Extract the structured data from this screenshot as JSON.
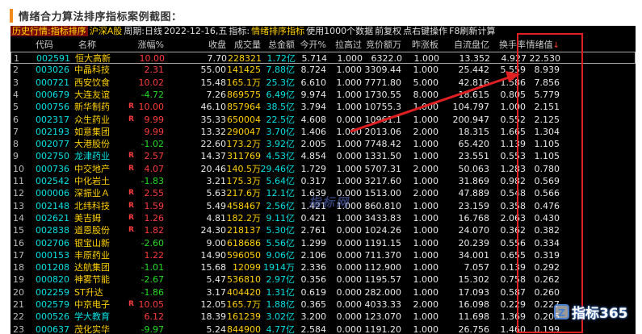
{
  "article": {
    "heading": "情绪合力算法排序指标案例截图："
  },
  "infobar": {
    "mode": "历史行情:指标排序",
    "sector": "沪深A股",
    "period": "周期:日线",
    "date": "2022-12-16,五",
    "indicator_label": "指标:",
    "indicator": "情绪排序指标",
    "data_note": "使用1000个数据",
    "adjust": "前复权",
    "hint": "点右键操作",
    "refresh": "F8刷新计算"
  },
  "columns": {
    "code": "代码",
    "name": "名称",
    "change": "涨幅%",
    "close": "收盘",
    "volume": "成交量",
    "amount": "总金额",
    "ratio": "今开%",
    "liangbi": "拉高过",
    "jingjia": "竞价额万",
    "zuozhang": "昨涨板",
    "liutong": "自流盘亿",
    "turnover": "换手率",
    "emotion": "情绪值",
    "sort_mark": "↓"
  },
  "rows": [
    {
      "idx": "1",
      "code": "002591",
      "name": "恒大高新",
      "r": "",
      "change": "10.00",
      "close": "7.70",
      "volume": "228321",
      "amount": "1.72亿",
      "ratio": "5.714",
      "liangbi": "1.000",
      "jingjia": "6322.0",
      "zuozhang": "1.000",
      "liutong": "13.352",
      "turnover": "4.927",
      "emotion": "22.530",
      "dir": "up"
    },
    {
      "idx": "2",
      "code": "003026",
      "name": "中晶科技",
      "r": "",
      "change": "2.31",
      "close": "55.00",
      "volume": "141425",
      "amount": "7.88亿",
      "ratio": "8.724",
      "liangbi": "1.000",
      "jingjia": "3309.44",
      "zuozhang": "1.000",
      "liutong": "25.442",
      "turnover": "5.559",
      "emotion": "8.939",
      "dir": "up"
    },
    {
      "idx": "3",
      "code": "000721",
      "name": "西安饮食",
      "r": "",
      "change": "10.02",
      "close": "15.48",
      "volume": "165.1万",
      "amount": "25.3亿",
      "ratio": "6.610",
      "liangbi": "1.000",
      "jingjia": "7771.80",
      "zuozhang": "5.000",
      "liutong": "42.816",
      "turnover": "1.586",
      "emotion": "7.856",
      "dir": "up"
    },
    {
      "idx": "4",
      "code": "000679",
      "name": "大连友谊",
      "r": "",
      "change": "-4.72",
      "close": "7.26",
      "volume": "869575",
      "amount": "6.49亿",
      "ratio": "9.974",
      "liangbi": "1.000",
      "jingjia": "1730.55",
      "zuozhang": "8.000",
      "liutong": "18.615",
      "turnover": "0.805",
      "emotion": "5.779",
      "dir": "down"
    },
    {
      "idx": "5",
      "code": "000756",
      "name": "新华制药",
      "r": "R",
      "change": "10.00",
      "close": "46.10",
      "volume": "857964",
      "amount": "38.5亿",
      "ratio": "3.794",
      "liangbi": "1.000",
      "jingjia": "10755.3",
      "zuozhang": "1.000",
      "liutong": "104.797",
      "turnover": "1.000",
      "emotion": "2.151",
      "dir": "up"
    },
    {
      "idx": "6",
      "code": "002317",
      "name": "众生药业",
      "r": "R",
      "change": "9.99",
      "close": "35.33",
      "volume": "650004",
      "amount": "22.5亿",
      "ratio": "4.608",
      "liangbi": "0.000",
      "jingjia": "10961.1",
      "zuozhang": "1.000",
      "liutong": "200.947",
      "turnover": "0.552",
      "emotion": "2.125",
      "dir": "up"
    },
    {
      "idx": "7",
      "code": "002193",
      "name": "如意集团",
      "r": "",
      "change": "9.99",
      "close": "13.32",
      "volume": "290047",
      "amount": "3.70亿",
      "ratio": "1.406",
      "liangbi": "1.000",
      "jingjia": "2013.06",
      "zuozhang": "2.000",
      "liutong": "18.315",
      "turnover": "1.665",
      "emotion": "1.304",
      "dir": "up"
    },
    {
      "idx": "8",
      "code": "002077",
      "name": "大港股份",
      "r": "",
      "change": "-1.02",
      "close": "22.60",
      "volume": "173.2万",
      "amount": "3.92亿",
      "ratio": "2.005",
      "liangbi": "1.000",
      "jingjia": "7748.42",
      "zuozhang": "1.000",
      "liutong": "65.420",
      "turnover": "1.139",
      "emotion": "1.105",
      "dir": "down"
    },
    {
      "idx": "9",
      "code": "002750",
      "name": "龙津药业",
      "r": "R",
      "change": "2.57",
      "close": "14.37",
      "volume": "311769",
      "amount": "4.53亿",
      "ratio": "4.854",
      "liangbi": "0.000",
      "jingjia": "1331.50",
      "zuozhang": "1.000",
      "liutong": "23.551",
      "turnover": "0.553",
      "emotion": "1.105",
      "dir": "up",
      "name_color": "cyan"
    },
    {
      "idx": "10",
      "code": "000736",
      "name": "中交地产",
      "r": "R",
      "change": "4.07",
      "close": "20.46",
      "volume": "140.5万",
      "amount": "29.46亿",
      "ratio": "1.729",
      "liangbi": "1.000",
      "jingjia": "5707.31",
      "zuozhang": "2.000",
      "liutong": "50.063",
      "turnover": "1.283",
      "emotion": "0.780",
      "dir": "up"
    },
    {
      "idx": "11",
      "code": "002542",
      "name": "中化岩土",
      "r": "",
      "change": "-1.83",
      "close": "3.21",
      "volume": "175.3万",
      "amount": "5.64亿",
      "ratio": "0.317",
      "liangbi": "1.000",
      "jingjia": "3217.60",
      "zuozhang": "1.000",
      "liutong": "31.869",
      "turnover": "0.982",
      "emotion": "0.569",
      "dir": "down"
    },
    {
      "idx": "12",
      "code": "000006",
      "name": "深振业Ａ",
      "r": "R",
      "change": "2.55",
      "close": "5.63",
      "volume": "217.6万",
      "amount": "12.1亿",
      "ratio": "1.639",
      "liangbi": "0.000",
      "jingjia": "1513.00",
      "zuozhang": "2.000",
      "liutong": "47.889",
      "turnover": "0.548",
      "emotion": "0.566",
      "dir": "up"
    },
    {
      "idx": "13",
      "code": "002148",
      "name": "北纬科技",
      "r": "R",
      "change": "1.59",
      "close": "5.49",
      "volume": "458467",
      "amount": "2.56亿",
      "ratio": "1.421",
      "liangbi": "1.000",
      "jingjia": "860.810",
      "zuozhang": "1.000",
      "liutong": "23.159",
      "turnover": "0.358",
      "emotion": "0.476",
      "dir": "up"
    },
    {
      "idx": "14",
      "code": "002621",
      "name": "美吉姆",
      "r": "R",
      "change": "1.26",
      "close": "4.81",
      "volume": "182.2万",
      "amount": "9.11亿",
      "ratio": "0.421",
      "liangbi": "1.000",
      "jingjia": "3433.83",
      "zuozhang": "1.000",
      "liutong": "16.768",
      "turnover": "2.063",
      "emotion": "0.430",
      "dir": "up"
    },
    {
      "idx": "15",
      "code": "002838",
      "name": "道恩股份",
      "r": "R",
      "change": "1.82",
      "close": "24.30",
      "volume": "218137",
      "amount": "5.30亿",
      "ratio": "2.761",
      "liangbi": "0.000",
      "jingjia": "1024.26",
      "zuozhang": "1.000",
      "liutong": "24.070",
      "turnover": "0.362",
      "emotion": "0.382",
      "dir": "up"
    },
    {
      "idx": "16",
      "code": "002706",
      "name": "银宝山新",
      "r": "",
      "change": "-2.60",
      "close": "9.00",
      "volume": "618686",
      "amount": "5.56亿",
      "ratio": "1.299",
      "liangbi": "0.000",
      "jingjia": "1191.15",
      "zuozhang": "1.000",
      "liutong": "20.239",
      "turnover": "0.556",
      "emotion": "0.334",
      "dir": "down"
    },
    {
      "idx": "17",
      "code": "000153",
      "name": "丰原药业",
      "r": "",
      "change": "1.22",
      "close": "14.90",
      "volume": "596050",
      "amount": "9.06亿",
      "ratio": "2.106",
      "liangbi": "0.000",
      "jingjia": "711.370",
      "zuozhang": "1.000",
      "liutong": "34.001",
      "turnover": "0.655",
      "emotion": "0.319",
      "dir": "up"
    },
    {
      "idx": "18",
      "code": "001208",
      "name": "达航集团",
      "r": "",
      "change": "-1.01",
      "close": "15.68",
      "volume": "12099",
      "amount": "1914万",
      "ratio": "2.336",
      "liangbi": "0.000",
      "jingjia": "112.900",
      "zuozhang": "1.000",
      "liutong": "7.057",
      "turnover": "0.139",
      "emotion": "0.292",
      "dir": "down"
    },
    {
      "idx": "19",
      "code": "000820",
      "name": "神雾节能",
      "r": "",
      "change": "-2.67",
      "close": "5.47",
      "volume": "536810",
      "amount": "2.97亿",
      "ratio": "0.356",
      "liangbi": "0.000",
      "jingjia": "1195.57",
      "zuozhang": "1.000",
      "liutong": "15.302",
      "turnover": "0.758",
      "emotion": "0.262",
      "dir": "down"
    },
    {
      "idx": "20",
      "code": "002259",
      "name": "ST升达",
      "r": "",
      "change": "-1.86",
      "close": "3.17",
      "volume": "404420",
      "amount": "1.31亿",
      "ratio": "0.619",
      "liangbi": "0.000",
      "jingjia": "282.000",
      "zuozhang": "1.000",
      "liutong": "17.093",
      "turnover": "0.587",
      "emotion": "0.260",
      "dir": "down"
    },
    {
      "idx": "21",
      "code": "002579",
      "name": "中京电子",
      "r": "R",
      "change": "10.05",
      "close": "12.05",
      "volume": "165.7万",
      "amount": "1.88亿",
      "ratio": "0.365",
      "liangbi": "0.000",
      "jingjia": "4033.33",
      "zuozhang": "2.000",
      "liutong": "16.098",
      "turnover": "0.229",
      "emotion": "0.227",
      "dir": "up"
    },
    {
      "idx": "22",
      "code": "000526",
      "name": "学大教育",
      "r": "",
      "change": "6.12",
      "close": "18.39",
      "volume": "161239",
      "amount": "3.02亿",
      "ratio": "3.200",
      "liangbi": "0.000",
      "jingjia": "123.070",
      "zuozhang": "1.000",
      "liutong": "11.698",
      "turnover": "1.369",
      "emotion": "0.205",
      "dir": "up",
      "name_color": "cyan"
    },
    {
      "idx": "23",
      "code": "000637",
      "name": "茂化实华",
      "r": "",
      "change": "-9.97",
      "close": "5.24",
      "volume": "844900",
      "amount": "4.77亿",
      "ratio": "2.584",
      "liangbi": "0.000",
      "jingjia": "1191.20",
      "zuozhang": "1.000",
      "liutong": "26.756",
      "turnover": "1.460",
      "emotion": "0.199",
      "dir": "down"
    }
  ],
  "watermark": {
    "center": "指标网",
    "logo_text": "指标365",
    "logo_letter": "Z"
  },
  "colors": {
    "accent_bar": "#f08c1e",
    "highlight_box": "#e02020",
    "up": "#ff3c3c",
    "down": "#22dd22"
  }
}
